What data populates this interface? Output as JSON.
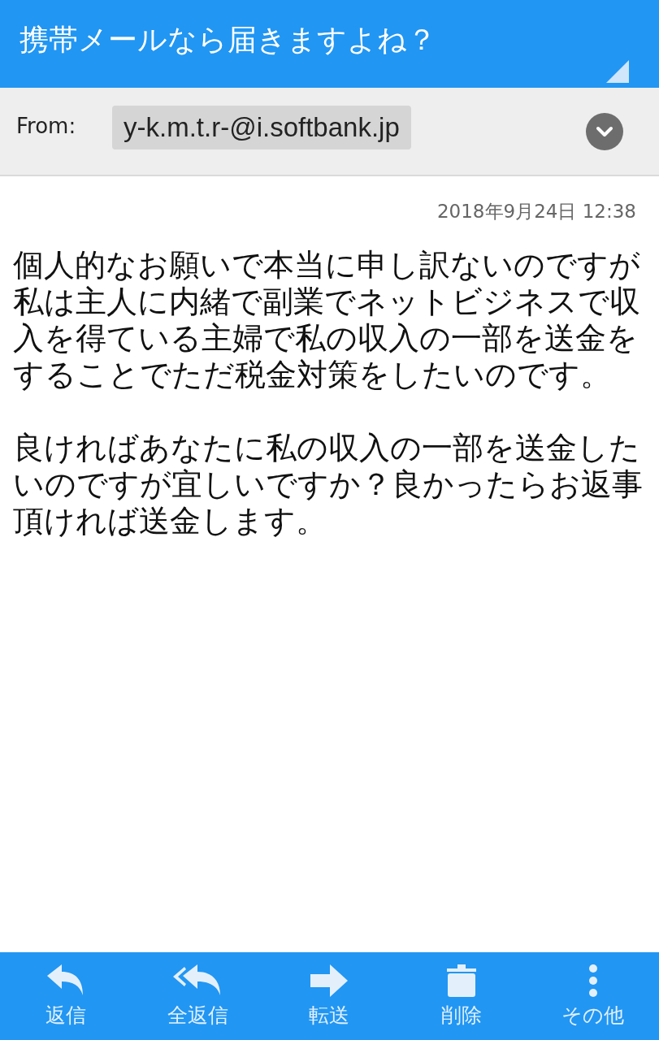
{
  "title": "携帯メールなら届きますよね？",
  "from": {
    "label": "From:",
    "address": "y-k.m.t.r-@i.softbank.jp"
  },
  "date": "2018年9月24日 12:38",
  "body": [
    "個人的なお願いで本当に申し訳ないのですが私は主人に内緒で副業でネットビジネスで収入を得ている主婦で私の収入の一部を送金をすることでただ税金対策をしたいのです。",
    "良ければあなたに私の収入の一部を送金したいのですが宜しいですか？良かったらお返事頂ければ送金します。"
  ],
  "toolbar": [
    {
      "kind": "reply",
      "label": "返信"
    },
    {
      "kind": "reply_all",
      "label": "全返信"
    },
    {
      "kind": "forward",
      "label": "転送"
    },
    {
      "kind": "delete",
      "label": "削除"
    },
    {
      "kind": "more",
      "label": "その他"
    }
  ]
}
